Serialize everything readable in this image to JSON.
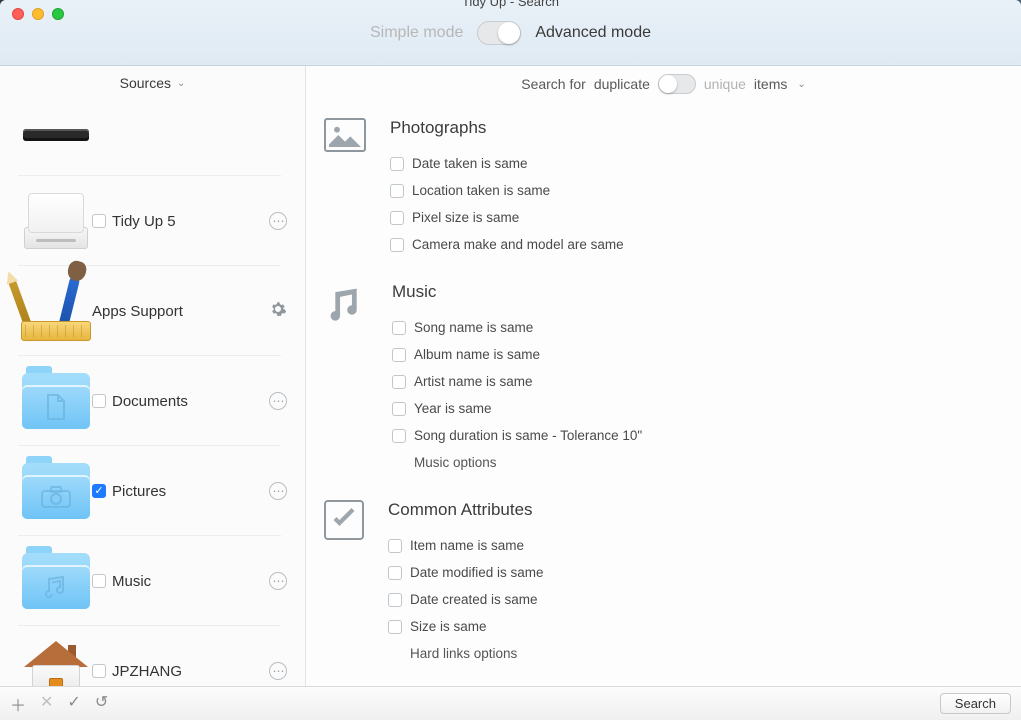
{
  "window": {
    "title": "Tidy Up - Search"
  },
  "modes": {
    "simple": "Simple mode",
    "advanced": "Advanced mode"
  },
  "sidebar": {
    "header": "Sources",
    "items": [
      {
        "label": "Tidy Up 5",
        "checked": false,
        "hasCheckbox": true
      },
      {
        "label": "Apps Support",
        "checked": false,
        "hasCheckbox": false
      },
      {
        "label": "Documents",
        "checked": false,
        "hasCheckbox": true
      },
      {
        "label": "Pictures",
        "checked": true,
        "hasCheckbox": true
      },
      {
        "label": "Music",
        "checked": false,
        "hasCheckbox": true
      },
      {
        "label": "JPZHANG",
        "checked": false,
        "hasCheckbox": true
      }
    ]
  },
  "subbar": {
    "prefix": "Search for",
    "active": "duplicate",
    "inactive": "unique",
    "suffix": "items"
  },
  "sections": {
    "photos": {
      "title": "Photographs",
      "opts": [
        "Date taken is same",
        "Location taken is same",
        "Pixel size is same",
        "Camera make and model are same"
      ]
    },
    "music": {
      "title": "Music",
      "opts": [
        "Song name is same",
        "Album name is same",
        "Artist name is same",
        "Year is same",
        "Song duration is same - Tolerance 10\""
      ],
      "link": "Music options"
    },
    "common": {
      "title": "Common Attributes",
      "opts": [
        "Item name is same",
        "Date modified is same",
        "Date created is same",
        "Size is same"
      ],
      "link": "Hard links options"
    }
  },
  "footer": {
    "search": "Search"
  }
}
